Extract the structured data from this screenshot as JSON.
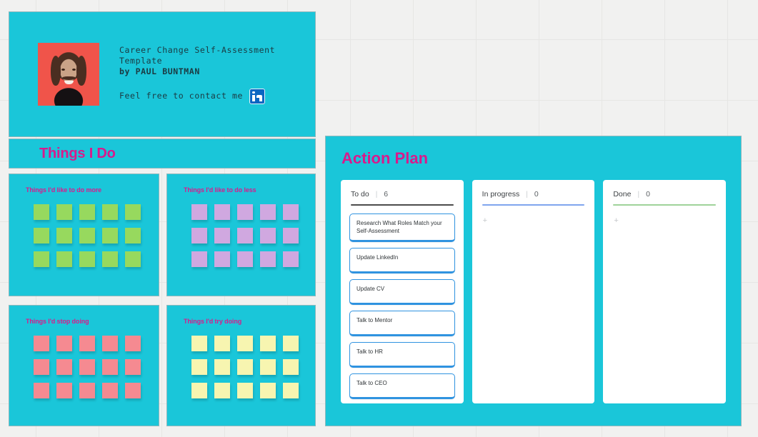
{
  "intro": {
    "title_lines": "Career Change Self-Assessment\nTemplate",
    "byline": "by PAUL BUNTMAN",
    "contact_text": "Feel free to contact me",
    "linkedin_icon": "linkedin-icon",
    "avatar_alt": "photo of man with long hair and mustache on red background"
  },
  "things_i_do": {
    "title": "Things I Do",
    "quadrants": [
      {
        "label": "Things I'd like to do more",
        "color": "#97d95e",
        "note_count": 15
      },
      {
        "label": "Things I'd like to do less",
        "color": "#d0a8e0",
        "note_count": 15
      },
      {
        "label": "Things I'd stop doing",
        "color": "#f58a91",
        "note_count": 15
      },
      {
        "label": "Things I'd try doing",
        "color": "#f7f5b0",
        "note_count": 15
      }
    ]
  },
  "action_plan": {
    "title": "Action Plan",
    "separator": "|",
    "add_label": "+",
    "columns": [
      {
        "name": "To do",
        "count": "6",
        "rule_color": "#4c4c4c",
        "cards": [
          "Research What Roles Match your Self-Assessment",
          "Update LinkedIn",
          "Update CV",
          "Talk to Mentor",
          "Talk to HR",
          "Talk to CEO"
        ]
      },
      {
        "name": "In progress",
        "count": "0",
        "rule_color": "#7fa5ee",
        "cards": []
      },
      {
        "name": "Done",
        "count": "0",
        "rule_color": "#9fd39a",
        "cards": []
      }
    ]
  },
  "theme": {
    "board_bg": "#1ac6d9",
    "accent_pink": "#d91a8c",
    "canvas_bg": "#f1f1f0",
    "card_border_blue": "#2f93e0"
  }
}
